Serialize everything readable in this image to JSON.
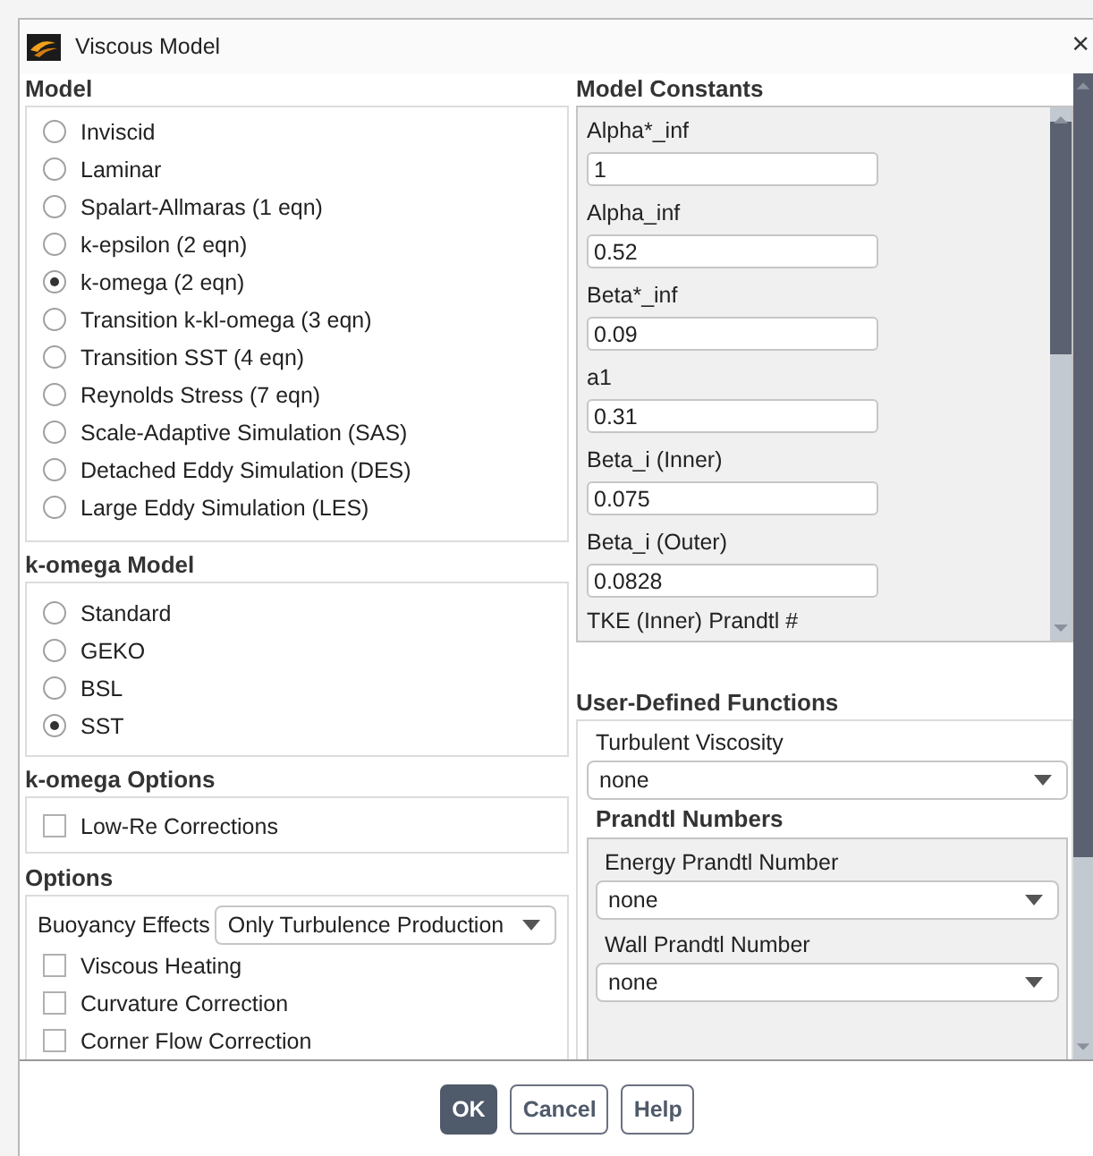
{
  "window": {
    "title": "Viscous Model",
    "close": "×"
  },
  "model": {
    "title": "Model",
    "options": [
      {
        "label": "Inviscid",
        "selected": false
      },
      {
        "label": "Laminar",
        "selected": false
      },
      {
        "label": "Spalart-Allmaras (1 eqn)",
        "selected": false
      },
      {
        "label": "k-epsilon (2 eqn)",
        "selected": false
      },
      {
        "label": "k-omega (2 eqn)",
        "selected": true
      },
      {
        "label": "Transition k-kl-omega (3 eqn)",
        "selected": false
      },
      {
        "label": "Transition SST (4 eqn)",
        "selected": false
      },
      {
        "label": "Reynolds Stress (7 eqn)",
        "selected": false
      },
      {
        "label": "Scale-Adaptive Simulation (SAS)",
        "selected": false
      },
      {
        "label": "Detached Eddy Simulation (DES)",
        "selected": false
      },
      {
        "label": "Large Eddy Simulation (LES)",
        "selected": false
      }
    ]
  },
  "k_omega_model": {
    "title": "k-omega Model",
    "options": [
      {
        "label": "Standard",
        "selected": false
      },
      {
        "label": "GEKO",
        "selected": false
      },
      {
        "label": "BSL",
        "selected": false
      },
      {
        "label": "SST",
        "selected": true
      }
    ]
  },
  "k_omega_options": {
    "title": "k-omega Options",
    "checkboxes": [
      {
        "label": "Low-Re Corrections",
        "checked": false
      }
    ]
  },
  "options": {
    "title": "Options",
    "buoyancy": {
      "label": "Buoyancy Effects",
      "value": "Only Turbulence Production"
    },
    "checkboxes": [
      {
        "label": "Viscous Heating",
        "checked": false
      },
      {
        "label": "Curvature Correction",
        "checked": false
      },
      {
        "label": "Corner Flow Correction",
        "checked": false
      }
    ]
  },
  "model_constants": {
    "title": "Model Constants",
    "constants": [
      {
        "label": "Alpha*_inf",
        "value": "1"
      },
      {
        "label": "Alpha_inf",
        "value": "0.52"
      },
      {
        "label": "Beta*_inf",
        "value": "0.09"
      },
      {
        "label": "a1",
        "value": "0.31"
      },
      {
        "label": "Beta_i (Inner)",
        "value": "0.075"
      },
      {
        "label": "Beta_i (Outer)",
        "value": "0.0828"
      }
    ],
    "cut_label": "TKE (Inner) Prandtl #"
  },
  "udf": {
    "title": "User-Defined Functions",
    "turbulent_viscosity": {
      "label": "Turbulent Viscosity",
      "value": "none"
    },
    "prandtl": {
      "title": "Prandtl Numbers",
      "fields": [
        {
          "label": "Energy Prandtl Number",
          "value": "none"
        },
        {
          "label": "Wall Prandtl Number",
          "value": "none"
        }
      ]
    }
  },
  "buttons": [
    {
      "label": "OK",
      "kind": "primary"
    },
    {
      "label": "Cancel",
      "kind": "normal"
    },
    {
      "label": "Help",
      "kind": "normal"
    }
  ]
}
